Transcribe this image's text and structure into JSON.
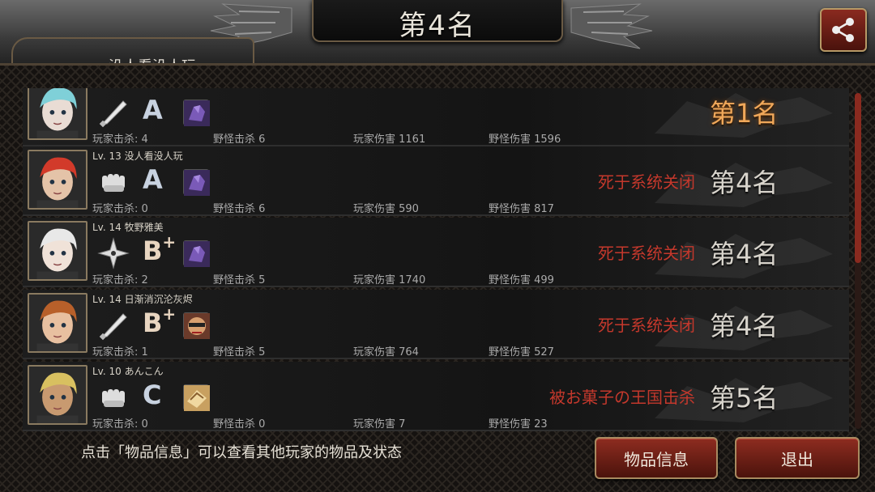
{
  "header": {
    "title": "第4名",
    "player_tab_text": "没人看没人玩"
  },
  "rows": [
    {
      "level": "",
      "name": "",
      "weapon": "bat-icon",
      "grade": "A",
      "grade_plus": "",
      "item": "purple-gem-item",
      "death": "",
      "rank": "第1名",
      "stats": {
        "player_kills": "玩家击杀: 4",
        "monster_kills": "野怪击杀 6",
        "player_damage": "玩家伤害 1161",
        "monster_damage": "野怪伤害 1596"
      }
    },
    {
      "level": "Lv. 13",
      "name": "没人看没人玩",
      "weapon": "fist-icon",
      "grade": "A",
      "grade_plus": "",
      "item": "purple-gem-item",
      "death": "死于系统关闭",
      "rank": "第4名",
      "stats": {
        "player_kills": "玩家击杀: 0",
        "monster_kills": "野怪击杀 6",
        "player_damage": "玩家伤害 590",
        "monster_damage": "野怪伤害 817"
      }
    },
    {
      "level": "Lv. 14",
      "name": "牧野雅美",
      "weapon": "shuriken-icon",
      "grade": "B",
      "grade_plus": "+",
      "item": "purple-gem-item",
      "death": "死于系统关闭",
      "rank": "第4名",
      "stats": {
        "player_kills": "玩家击杀: 2",
        "monster_kills": "野怪击杀 5",
        "player_damage": "玩家伤害 1740",
        "monster_damage": "野怪伤害 499"
      }
    },
    {
      "level": "Lv. 14",
      "name": "日渐消沉沦灰烬",
      "weapon": "bat-icon",
      "grade": "B",
      "grade_plus": "+",
      "item": "face-item",
      "death": "死于系统关闭",
      "rank": "第4名",
      "stats": {
        "player_kills": "玩家击杀: 1",
        "monster_kills": "野怪击杀 5",
        "player_damage": "玩家伤害 764",
        "monster_damage": "野怪伤害 527"
      }
    },
    {
      "level": "Lv. 10",
      "name": "あんこん",
      "weapon": "fist-icon",
      "grade": "C",
      "grade_plus": "",
      "item": "gold-item",
      "death": "被お菓子の王国击杀",
      "rank": "第5名",
      "stats": {
        "player_kills": "玩家击杀: 0",
        "monster_kills": "野怪击杀 0",
        "player_damage": "玩家伤害 7",
        "monster_damage": "野怪伤害 23"
      }
    }
  ],
  "footer": {
    "hint": "点击「物品信息」可以查看其他玩家的物品及状态",
    "items_button": "物品信息",
    "exit_button": "退出"
  },
  "colors": {
    "accent_red": "#8e2c20",
    "death_text": "#c4382c",
    "first_rank": "#f0a85a"
  }
}
